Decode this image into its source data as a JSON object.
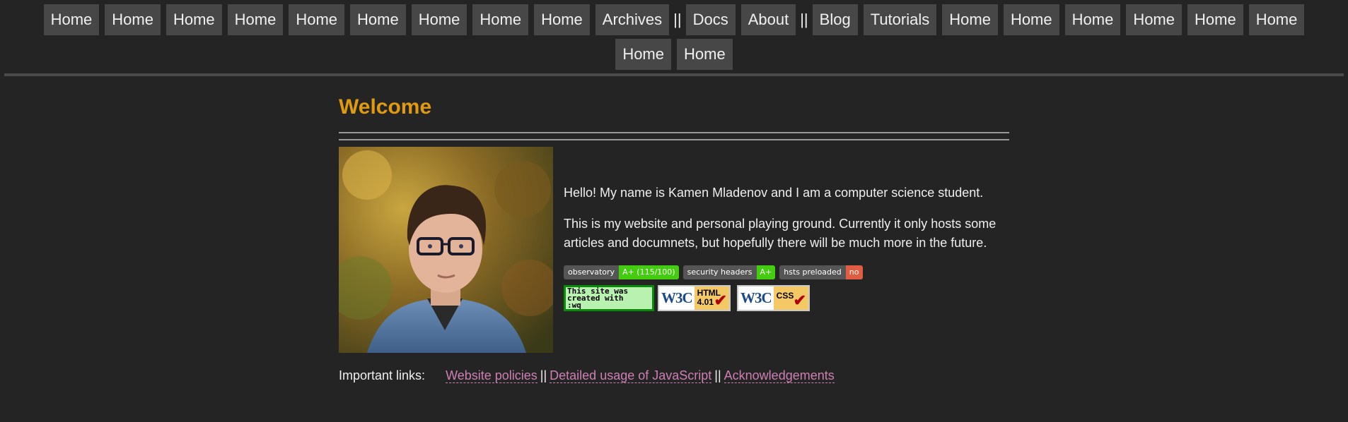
{
  "nav": {
    "items": [
      {
        "type": "button",
        "label": "Home"
      },
      {
        "type": "button",
        "label": "Home"
      },
      {
        "type": "button",
        "label": "Home"
      },
      {
        "type": "button",
        "label": "Home"
      },
      {
        "type": "button",
        "label": "Home"
      },
      {
        "type": "button",
        "label": "Home"
      },
      {
        "type": "button",
        "label": "Home"
      },
      {
        "type": "button",
        "label": "Home"
      },
      {
        "type": "button",
        "label": "Home"
      },
      {
        "type": "button",
        "label": "Archives"
      },
      {
        "type": "sep",
        "label": "||"
      },
      {
        "type": "button",
        "label": "Docs"
      },
      {
        "type": "button",
        "label": "About"
      },
      {
        "type": "sep",
        "label": "||"
      },
      {
        "type": "button",
        "label": "Blog"
      },
      {
        "type": "button",
        "label": "Tutorials"
      },
      {
        "type": "button",
        "label": "Home"
      },
      {
        "type": "button",
        "label": "Home"
      },
      {
        "type": "button",
        "label": "Home"
      },
      {
        "type": "button",
        "label": "Home"
      },
      {
        "type": "button",
        "label": "Home"
      },
      {
        "type": "button",
        "label": "Home"
      },
      {
        "type": "button",
        "label": "Home"
      },
      {
        "type": "button",
        "label": "Home"
      }
    ]
  },
  "page": {
    "title": "Welcome",
    "paragraphs": [
      "Hello! My name is Kamen Mladenov and I am a computer science student.",
      "This is my website and personal playing ground. Currently it only hosts some articles and documnets, but hopefully there will be much more in the future."
    ]
  },
  "badges": [
    {
      "label": "observatory",
      "value": "A+ (115/100)",
      "status": "green"
    },
    {
      "label": "security headers",
      "value": "A+",
      "status": "green"
    },
    {
      "label": "hsts preloaded",
      "value": "no",
      "status": "red"
    }
  ],
  "buttons88": {
    "vim": {
      "line1": "This site was",
      "line2": "created with",
      "line3": ":wq"
    },
    "w3c_html": {
      "logo": "W3C",
      "spec_line1": "HTML",
      "spec_line2": "4.01"
    },
    "w3c_css": {
      "logo": "W3C",
      "spec_line1": "CSS"
    }
  },
  "important_links": {
    "label": "Important links:",
    "separator": "||",
    "links": [
      "Website policies",
      "Detailed usage of JavaScript",
      "Acknowledgements"
    ]
  },
  "colors": {
    "background": "#242424",
    "title": "#e09a10",
    "link": "#cf7fb4",
    "nav_button": "#474747"
  }
}
